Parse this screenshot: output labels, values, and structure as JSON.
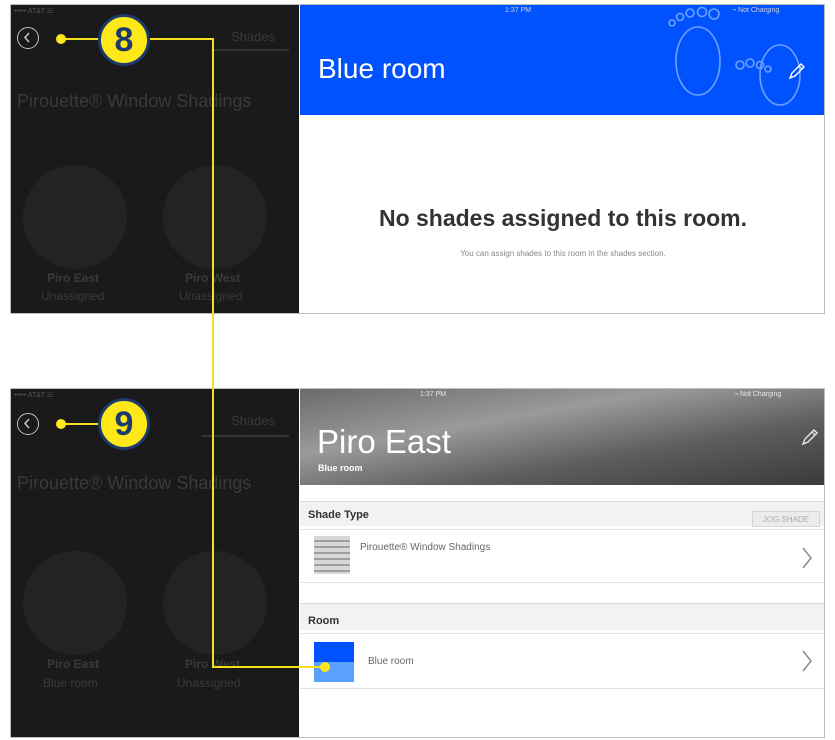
{
  "top": {
    "sidebar": {
      "status_left": "••••• AT&T ☱",
      "tab_label": "Shades",
      "title": "Pirouette® Window Shadings",
      "items": [
        {
          "name": "Piro East",
          "subtitle": "Unassigned"
        },
        {
          "name": "Piro West",
          "subtitle": "Unassigned"
        }
      ]
    },
    "header": {
      "status_time": "1:37 PM",
      "status_battery": "¬ Not Charging",
      "title": "Blue room",
      "bg_color": "#0052ff"
    },
    "empty": {
      "heading": "No shades assigned to this room.",
      "subtext": "You can assign shades to this room in the shades section."
    },
    "callout": "8"
  },
  "bottom": {
    "sidebar": {
      "status_left": "••••• AT&T ☱",
      "tab_label": "Shades",
      "title": "Pirouette® Window Shadings",
      "items": [
        {
          "name": "Piro East",
          "subtitle": "Blue room"
        },
        {
          "name": "Piro West",
          "subtitle": "Unassigned"
        }
      ]
    },
    "header": {
      "status_time": "1:37 PM",
      "status_battery": "¬ Not Charging",
      "title": "Piro East",
      "subtitle": "Blue room"
    },
    "shade_type": {
      "section_label": "Shade Type",
      "jog_label": "JOG SHADE",
      "value": "Pirouette® Window Shadings"
    },
    "room": {
      "section_label": "Room",
      "value": "Blue room"
    },
    "callout": "9"
  },
  "icons": {
    "back": "back-circle-icon",
    "edit": "pencil-icon",
    "chevron": "chevron-right-icon",
    "footprints": "footprints-icon"
  },
  "colors": {
    "accent_blue": "#0052ff",
    "callout_yellow": "#ffe81a",
    "callout_border": "#1c3a6e"
  }
}
